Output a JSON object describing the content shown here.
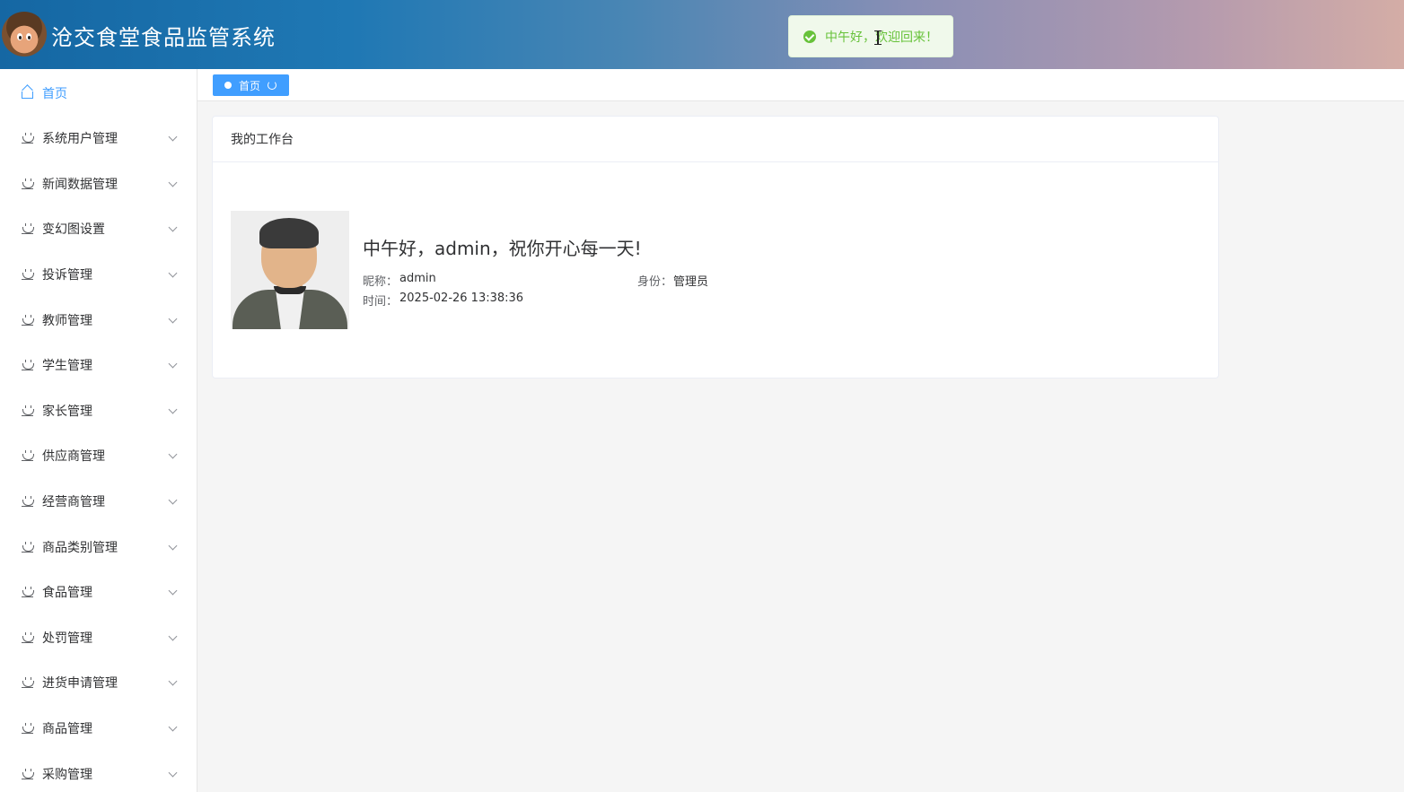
{
  "header": {
    "app_title": "沧交食堂食品监管系统"
  },
  "toast": {
    "type": "success",
    "message": "中午好，欢迎回来！"
  },
  "sidebar": {
    "items": [
      {
        "label": "首页",
        "icon": "home-icon",
        "active": true
      },
      {
        "label": "系统用户管理",
        "icon": "bowl-icon"
      },
      {
        "label": "新闻数据管理",
        "icon": "bowl-icon"
      },
      {
        "label": "变幻图设置",
        "icon": "bowl-icon"
      },
      {
        "label": "投诉管理",
        "icon": "bowl-icon"
      },
      {
        "label": "教师管理",
        "icon": "bowl-icon"
      },
      {
        "label": "学生管理",
        "icon": "bowl-icon"
      },
      {
        "label": "家长管理",
        "icon": "bowl-icon"
      },
      {
        "label": "供应商管理",
        "icon": "bowl-icon"
      },
      {
        "label": "经营商管理",
        "icon": "bowl-icon"
      },
      {
        "label": "商品类别管理",
        "icon": "bowl-icon"
      },
      {
        "label": "食品管理",
        "icon": "bowl-icon"
      },
      {
        "label": "处罚管理",
        "icon": "bowl-icon"
      },
      {
        "label": "进货申请管理",
        "icon": "bowl-icon"
      },
      {
        "label": "商品管理",
        "icon": "bowl-icon"
      },
      {
        "label": "采购管理",
        "icon": "bowl-icon"
      }
    ]
  },
  "tabs": [
    {
      "label": "首页",
      "active": true
    }
  ],
  "workbench": {
    "title": "我的工作台",
    "greeting": "中午好，admin，祝你开心每一天!",
    "nickname_label": "昵称：",
    "nickname": "admin",
    "role_label": "身份：",
    "role": "管理员",
    "time_label": "时间：",
    "time": "2025-02-26 13:38:36"
  },
  "colors": {
    "accent": "#409eff",
    "success": "#67c23a",
    "header_start": "#1567a3",
    "header_end": "#d4ada6"
  }
}
